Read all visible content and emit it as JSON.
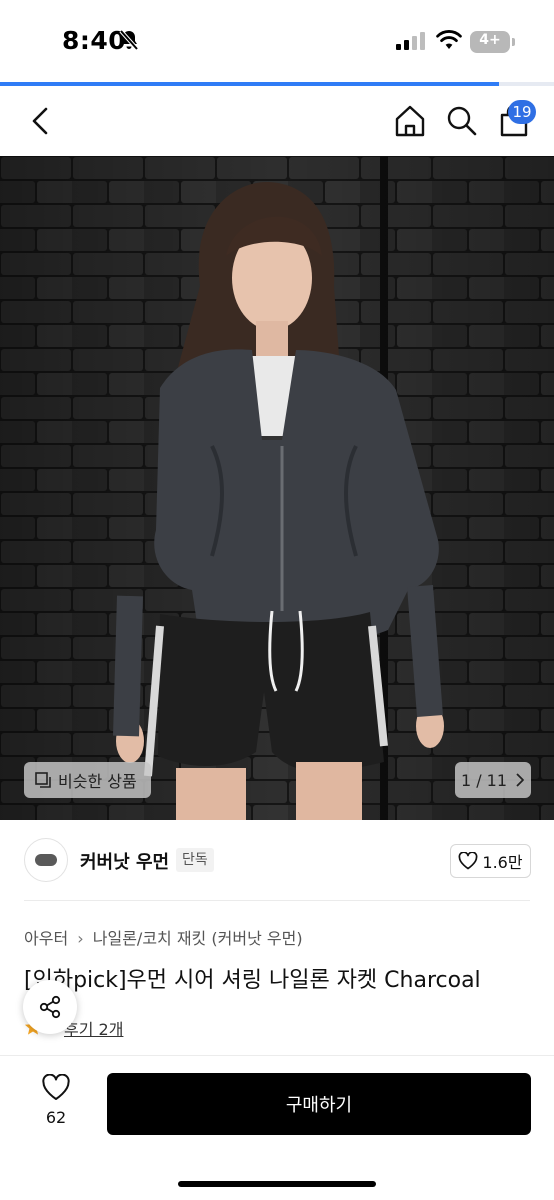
{
  "status_bar": {
    "time": "8:40",
    "battery": "4+"
  },
  "loading": {
    "progress": 0.9
  },
  "nav": {
    "cart_count": "19"
  },
  "gallery": {
    "similar_label": "비슷한 상품",
    "counter": "1 / 11"
  },
  "shop": {
    "name": "커버낫 우먼",
    "tag": "단독",
    "likes": "1.6만"
  },
  "breadcrumb": {
    "category": "아우터",
    "subcategory": "나일론/코치 재킷",
    "brand": "(커버낫 우먼)"
  },
  "product": {
    "title": "[인하pick]우먼 시어 셔링 나일론 자켓 Charcoal",
    "review_label": "후기 2개"
  },
  "bottom": {
    "wish_count": "62",
    "buy_label": "구매하기"
  },
  "colors": {
    "accent": "#2f7cf6",
    "badge": "#2f6fe4",
    "star": "#f5a623",
    "buy_button": "#000000"
  }
}
